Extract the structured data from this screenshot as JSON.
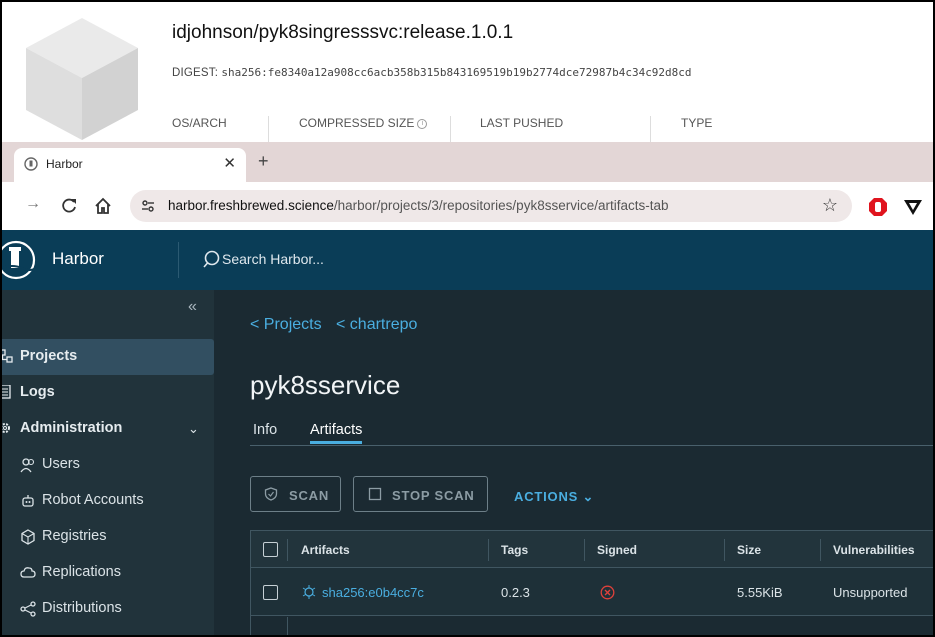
{
  "artifact": {
    "title": "idjohnson/pyk8singresssvc:release.1.0.1",
    "digest_label": "DIGEST:",
    "digest_value": "sha256:fe8340a12a908cc6acb358b315b843169519b19b2774dce72987b4c34c92d8cd",
    "columns": [
      "OS/ARCH",
      "COMPRESSED SIZE",
      "LAST PUSHED",
      "TYPE"
    ]
  },
  "browser": {
    "tab_title": "Harbor",
    "tab_close": "✕",
    "new_tab": "+",
    "url_host": "harbor.freshbrewed.science",
    "url_path": "/harbor/projects/3/repositories/pyk8sservice/artifacts-tab"
  },
  "harbor": {
    "brand": "Harbor",
    "search_placeholder": "Search Harbor...",
    "sidebar": {
      "collapse": "«",
      "projects": "Projects",
      "logs": "Logs",
      "administration": "Administration",
      "users": "Users",
      "robot_accounts": "Robot Accounts",
      "registries": "Registries",
      "replications": "Replications",
      "distributions": "Distributions"
    },
    "breadcrumb": {
      "projects": "< Projects",
      "chartrepo": "< chartrepo"
    },
    "page_title": "pyk8sservice",
    "tabs": {
      "info": "Info",
      "artifacts": "Artifacts"
    },
    "buttons": {
      "scan": "SCAN",
      "stop_scan": "STOP SCAN",
      "actions": "ACTIONS ⌄"
    },
    "table": {
      "headers": [
        "Artifacts",
        "Tags",
        "Signed",
        "Size",
        "Vulnerabilities"
      ],
      "rows": [
        {
          "artifact": "sha256:e0b4cc7c",
          "tags": "0.2.3",
          "size": "5.55KiB",
          "vulnerabilities": "Unsupported"
        }
      ]
    }
  },
  "colors": {
    "header": "#0a3d57",
    "sidebar": "#21333b",
    "content": "#1b2a32",
    "accent": "#4aaee0",
    "error": "#e0413b"
  }
}
